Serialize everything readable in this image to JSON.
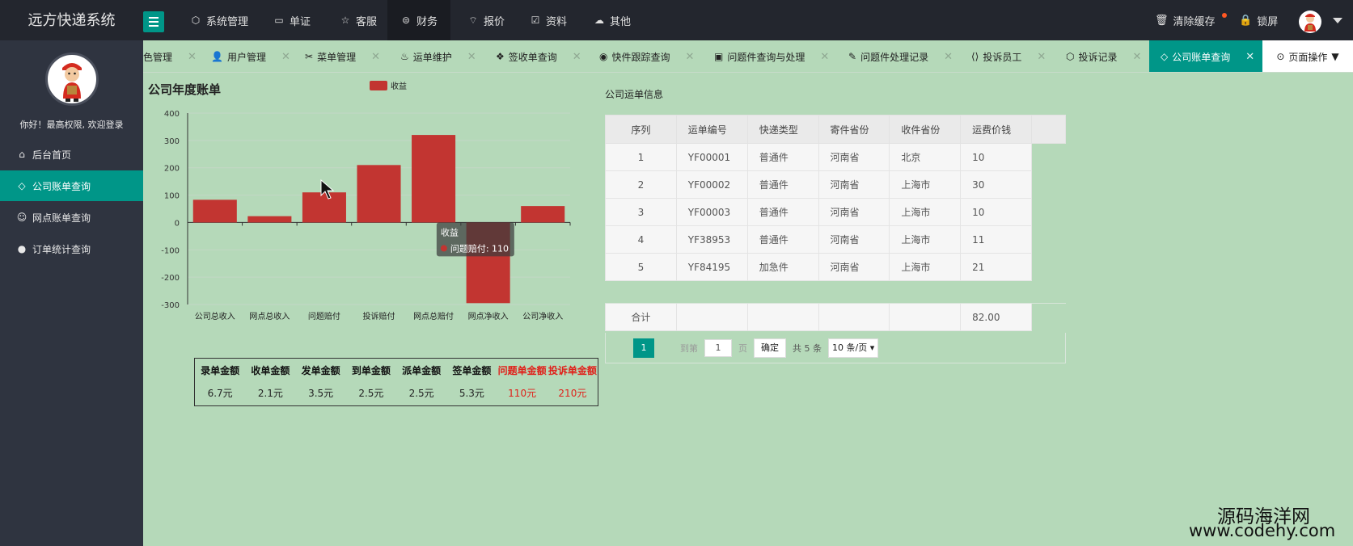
{
  "app": {
    "title": "远方快递系统"
  },
  "topnav": [
    {
      "label": "系统管理",
      "icon": "cube-icon"
    },
    {
      "label": "单证",
      "icon": "book-icon"
    },
    {
      "label": "客服",
      "icon": "star-icon"
    },
    {
      "label": "财务",
      "icon": "yen-circle-icon",
      "active": true
    },
    {
      "label": "报价",
      "icon": "signal-icon"
    },
    {
      "label": "资料",
      "icon": "edit-icon"
    },
    {
      "label": "其他",
      "icon": "cloud-icon"
    }
  ],
  "topright": {
    "clear_cache": "清除缓存",
    "lock_screen": "锁屏"
  },
  "sidebar": {
    "welcome": "你好！最高权限, 欢迎登录",
    "items": [
      {
        "label": "后台首页",
        "icon": "home-icon"
      },
      {
        "label": "公司账单查询",
        "icon": "diamond-icon",
        "active": true
      },
      {
        "label": "网点账单查询",
        "icon": "smile-icon"
      },
      {
        "label": "订单统计查询",
        "icon": "circle-icon"
      }
    ]
  },
  "tabs": [
    {
      "label": "色管理",
      "icon": ""
    },
    {
      "label": "用户管理",
      "icon": "user-icon"
    },
    {
      "label": "菜单管理",
      "icon": "scissors-icon"
    },
    {
      "label": "运单维护",
      "icon": "fire-icon"
    },
    {
      "label": "签收单查询",
      "icon": "compass-icon"
    },
    {
      "label": "快件跟踪查询",
      "icon": "github-icon"
    },
    {
      "label": "问题件查询与处理",
      "icon": "picture-icon"
    },
    {
      "label": "问题件处理记录",
      "icon": "edit-icon"
    },
    {
      "label": "投诉员工",
      "icon": "code-icon"
    },
    {
      "label": "投诉记录",
      "icon": "cube-icon"
    },
    {
      "label": "公司账单查询",
      "icon": "diamond-icon",
      "active": true
    }
  ],
  "page_ops": "页面操作",
  "chart_title": "公司年度账单",
  "chart_data": {
    "type": "bar",
    "legend": "收益",
    "categories": [
      "公司总收入",
      "网点总收入",
      "问题赔付",
      "投诉赔付",
      "网点总赔付",
      "网点净收入",
      "公司净收入"
    ],
    "values": [
      83,
      23,
      110,
      210,
      320,
      -295,
      60
    ],
    "ylim": [
      -300,
      400
    ],
    "yticks": [
      400,
      300,
      200,
      100,
      0,
      -100,
      -200,
      -300
    ],
    "color": "#c23531",
    "tooltip": {
      "series": "收益",
      "label": "问题赔付: 110"
    }
  },
  "summary": [
    {
      "header": "录单金额",
      "value": "6.7元"
    },
    {
      "header": "收单金额",
      "value": "2.1元"
    },
    {
      "header": "发单金额",
      "value": "3.5元"
    },
    {
      "header": "到单金额",
      "value": "2.5元"
    },
    {
      "header": "派单金额",
      "value": "2.5元"
    },
    {
      "header": "签单金额",
      "value": "5.3元"
    },
    {
      "header": "问题单金额",
      "value": "110元",
      "red": true
    },
    {
      "header": "投诉单金额",
      "value": "210元",
      "red": true
    }
  ],
  "table": {
    "title": "公司运单信息",
    "headers": [
      "序列",
      "运单编号",
      "快递类型",
      "寄件省份",
      "收件省份",
      "运费价钱"
    ],
    "rows": [
      [
        "1",
        "YF00001",
        "普通件",
        "河南省",
        "北京",
        "10"
      ],
      [
        "2",
        "YF00002",
        "普通件",
        "河南省",
        "上海市",
        "30"
      ],
      [
        "3",
        "YF00003",
        "普通件",
        "河南省",
        "上海市",
        "10"
      ],
      [
        "4",
        "YF38953",
        "普通件",
        "河南省",
        "上海市",
        "11"
      ],
      [
        "5",
        "YF84195",
        "加急件",
        "河南省",
        "上海市",
        "21"
      ]
    ],
    "total_label": "合计",
    "total_value": "82.00"
  },
  "pager": {
    "current": "1",
    "goto_prefix": "到第",
    "goto_value": "1",
    "goto_suffix": "页",
    "ok": "确定",
    "total": "共 5 条",
    "page_size": "10 条/页"
  },
  "watermark": {
    "line1": "源码海洋网",
    "line2": "www.codehy.com"
  }
}
